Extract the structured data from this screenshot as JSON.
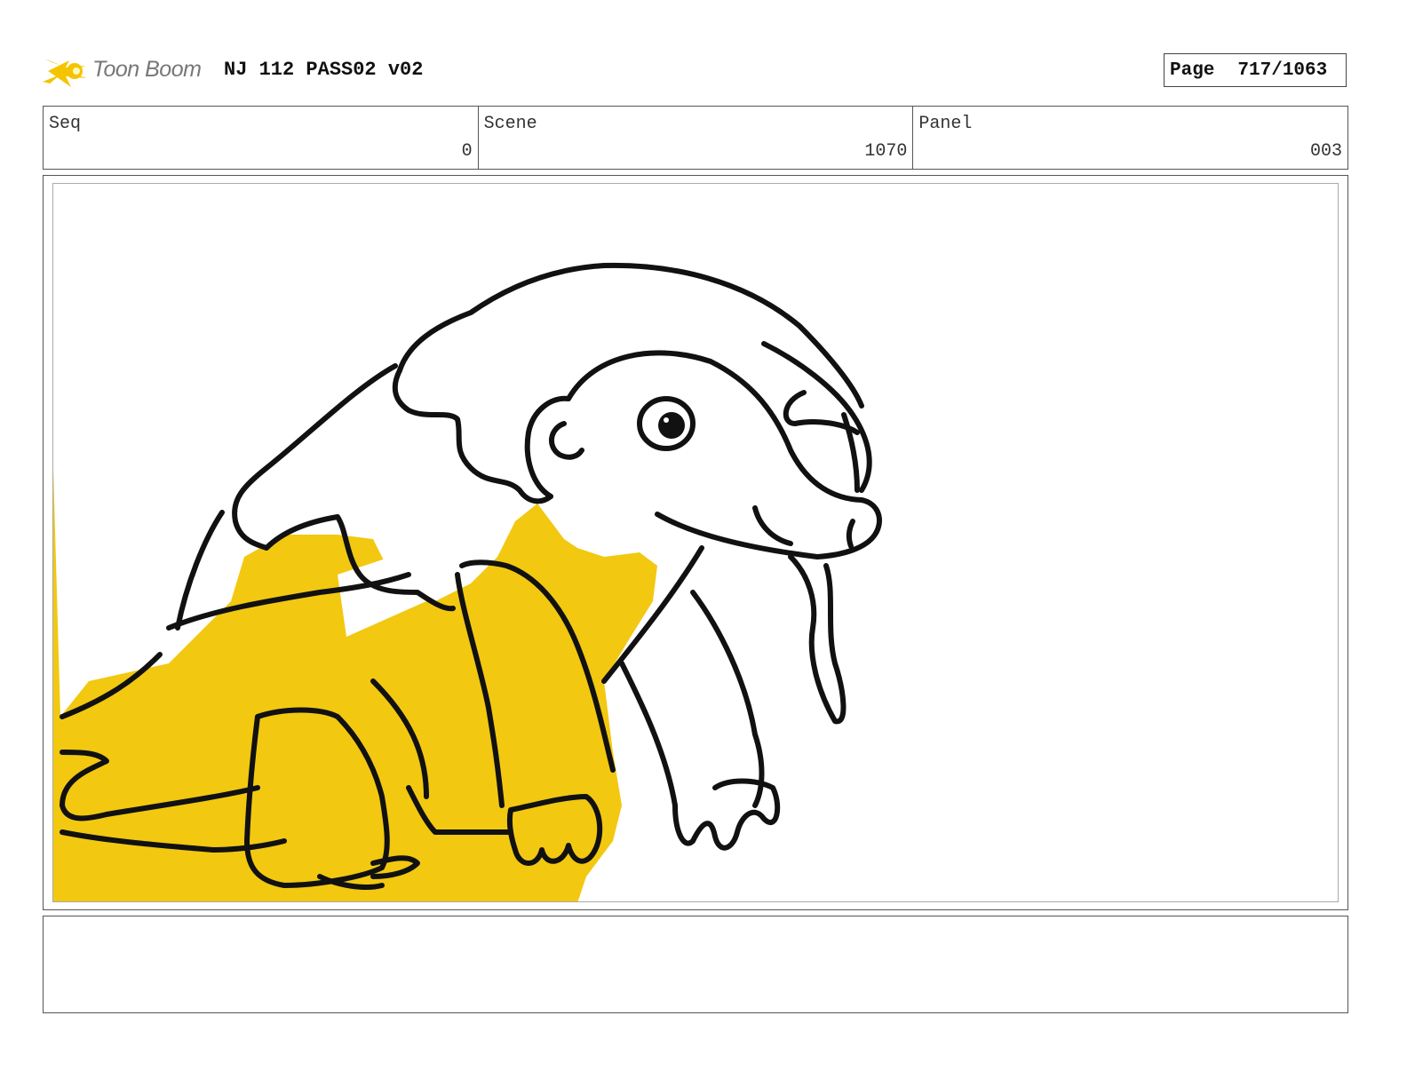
{
  "header": {
    "logo_text": "Toon Boom",
    "project_title": "NJ 112 PASS02 v02",
    "page_label": "Page",
    "page_value": "717/1063"
  },
  "info": {
    "seq_label": "Seq",
    "seq_value": "0",
    "scene_label": "Scene",
    "scene_value": "1070",
    "panel_label": "Panel",
    "panel_value": "003"
  },
  "colors": {
    "logo_star": "#f5c400",
    "fill_yellow": "#f2c811",
    "ink": "#111111"
  },
  "icons": {
    "logo": "toon-boom-star-icon"
  },
  "notes": {
    "text": ""
  }
}
